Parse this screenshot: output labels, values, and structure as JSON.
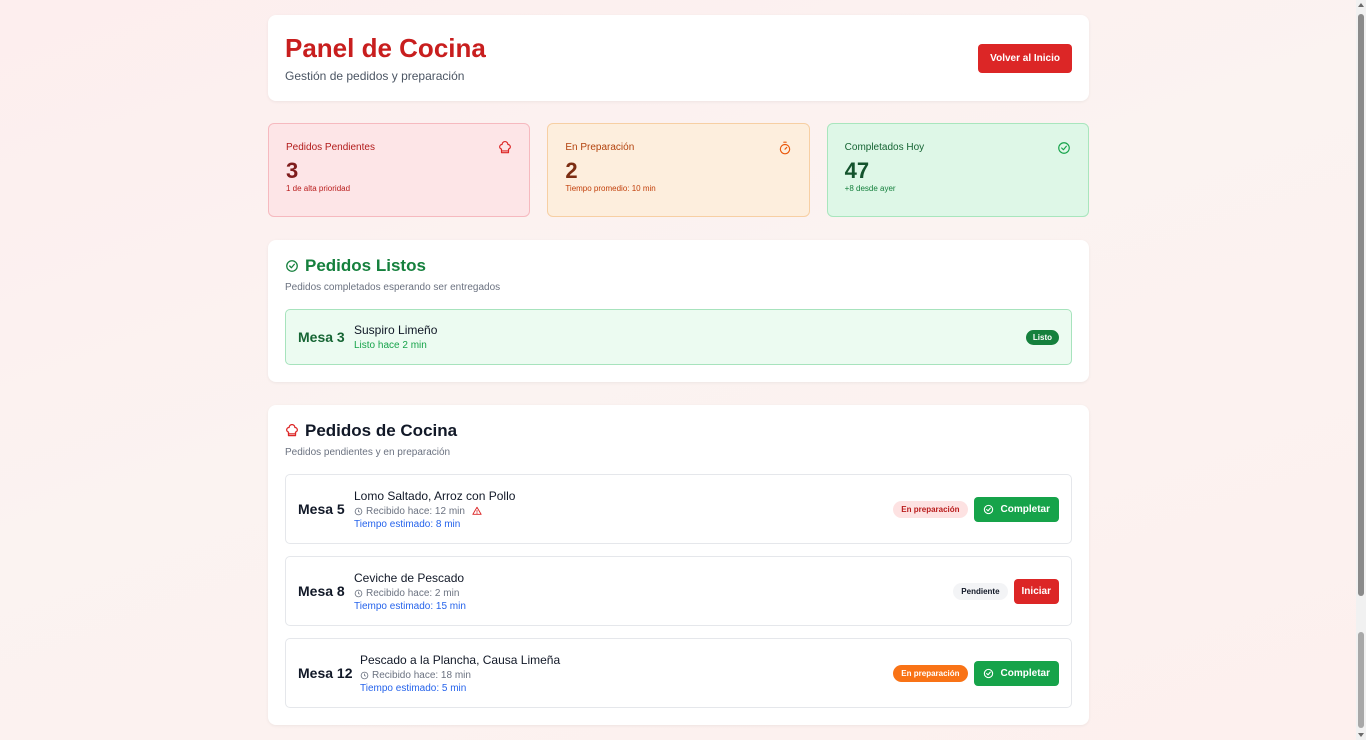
{
  "header": {
    "title": "Panel de Cocina",
    "subtitle": "Gestión de pedidos y preparación",
    "back_button": "Volver al Inicio"
  },
  "stats": [
    {
      "label": "Pedidos Pendientes",
      "value": "3",
      "note": "1 de alta prioridad",
      "icon": "chef-hat-icon"
    },
    {
      "label": "En Preparación",
      "value": "2",
      "note": "Tiempo promedio: 10 min",
      "icon": "timer-icon"
    },
    {
      "label": "Completados Hoy",
      "value": "47",
      "note": "+8 desde ayer",
      "icon": "check-circle-icon"
    }
  ],
  "ready_section": {
    "title": "Pedidos Listos",
    "description": "Pedidos completados esperando ser entregados",
    "items": [
      {
        "mesa": "Mesa 3",
        "dish": "Suspiro Limeño",
        "status_text": "Listo hace 2 min",
        "badge": "Listo"
      }
    ]
  },
  "kitchen_section": {
    "title": "Pedidos de Cocina",
    "description": "Pedidos pendientes y en preparación",
    "orders": [
      {
        "mesa": "Mesa 5",
        "dishes": "Lomo Saltado, Arroz con Pollo",
        "received": "Recibido hace: 12 min",
        "estimated": "Tiempo estimado: 8 min",
        "badge": "En preparación",
        "action": "Completar"
      },
      {
        "mesa": "Mesa 8",
        "dishes": "Ceviche de Pescado",
        "received": "Recibido hace: 2 min",
        "estimated": "Tiempo estimado: 15 min",
        "badge": "Pendiente",
        "action": "Iniciar"
      },
      {
        "mesa": "Mesa 12",
        "dishes": "Pescado a la Plancha, Causa Limeña",
        "received": "Recibido hace: 18 min",
        "estimated": "Tiempo estimado: 5 min",
        "badge": "En preparación",
        "action": "Completar"
      }
    ]
  },
  "colors": {
    "brand_red": "#dc2626",
    "success_green": "#16a34a",
    "warning_orange": "#f97316"
  }
}
